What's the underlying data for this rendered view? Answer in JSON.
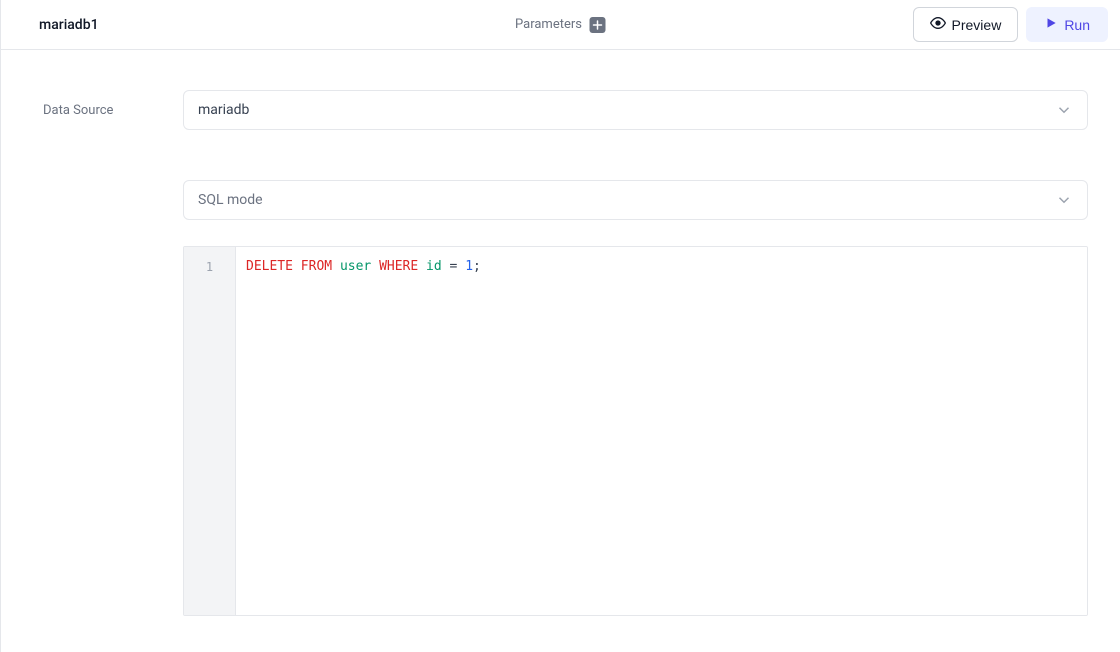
{
  "header": {
    "title": "mariadb1",
    "parameters_label": "Parameters",
    "preview_label": "Preview",
    "run_label": "Run"
  },
  "form": {
    "datasource_label": "Data Source",
    "datasource_value": "mariadb",
    "mode_value": "SQL mode"
  },
  "editor": {
    "line_number": "1",
    "sql": {
      "delete": "DELETE",
      "from": "FROM",
      "table": "user",
      "where": "WHERE",
      "column": "id",
      "eq": "=",
      "value": "1",
      "semi": ";"
    }
  }
}
